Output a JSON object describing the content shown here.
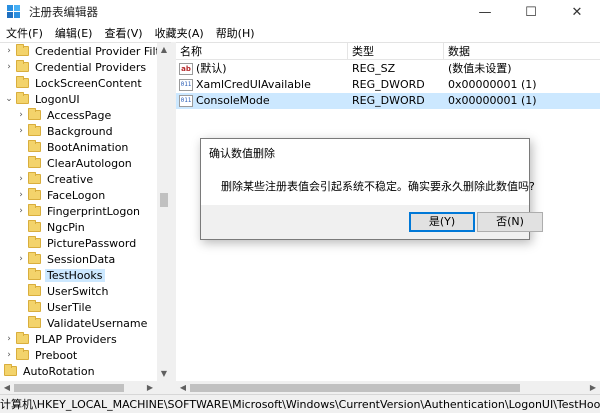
{
  "window": {
    "title": "注册表编辑器",
    "controls": {
      "minimize": "—",
      "maximize": "☐",
      "close": "✕"
    }
  },
  "menu": [
    {
      "label": "文件(F)"
    },
    {
      "label": "编辑(E)"
    },
    {
      "label": "查看(V)"
    },
    {
      "label": "收藏夹(A)"
    },
    {
      "label": "帮助(H)"
    }
  ],
  "tree": {
    "items": [
      {
        "label": "Credential Provider Filte",
        "expandable": true,
        "expanded": false,
        "selected": false
      },
      {
        "label": "Credential Providers",
        "expandable": true,
        "expanded": false,
        "selected": false
      },
      {
        "label": "LockScreenContent",
        "expandable": false,
        "expanded": false,
        "selected": false
      },
      {
        "label": "LogonUI",
        "expandable": true,
        "expanded": true,
        "selected": false
      },
      {
        "label": "AccessPage",
        "expandable": true,
        "expanded": false,
        "selected": false
      },
      {
        "label": "Background",
        "expandable": true,
        "expanded": false,
        "selected": false
      },
      {
        "label": "BootAnimation",
        "expandable": false,
        "expanded": false,
        "selected": false
      },
      {
        "label": "ClearAutologon",
        "expandable": false,
        "expanded": false,
        "selected": false
      },
      {
        "label": "Creative",
        "expandable": true,
        "expanded": false,
        "selected": false
      },
      {
        "label": "FaceLogon",
        "expandable": true,
        "expanded": false,
        "selected": false
      },
      {
        "label": "FingerprintLogon",
        "expandable": true,
        "expanded": false,
        "selected": false
      },
      {
        "label": "NgcPin",
        "expandable": false,
        "expanded": false,
        "selected": false
      },
      {
        "label": "PicturePassword",
        "expandable": false,
        "expanded": false,
        "selected": false
      },
      {
        "label": "SessionData",
        "expandable": true,
        "expanded": false,
        "selected": false
      },
      {
        "label": "TestHooks",
        "expandable": false,
        "expanded": false,
        "selected": true
      },
      {
        "label": "UserSwitch",
        "expandable": false,
        "expanded": false,
        "selected": false
      },
      {
        "label": "UserTile",
        "expandable": false,
        "expanded": false,
        "selected": false
      },
      {
        "label": "ValidateUsername",
        "expandable": false,
        "expanded": false,
        "selected": false
      },
      {
        "label": "PLAP Providers",
        "expandable": true,
        "expanded": false,
        "selected": false
      },
      {
        "label": "Preboot",
        "expandable": true,
        "expanded": false,
        "selected": false
      },
      {
        "label": "AutoRotation",
        "expandable": false,
        "expanded": false,
        "selected": false
      }
    ]
  },
  "list": {
    "columns": {
      "name": "名称",
      "type": "类型",
      "data": "数据"
    },
    "rows": [
      {
        "icon": "string-value-icon",
        "icon_text": "ab",
        "name": "(默认)",
        "type": "REG_SZ",
        "data": "(数值未设置)",
        "selected": false
      },
      {
        "icon": "dword-value-icon",
        "icon_text": "011",
        "name": "XamlCredUIAvailable",
        "type": "REG_DWORD",
        "data": "0x00000001 (1)",
        "selected": false
      },
      {
        "icon": "dword-value-icon",
        "icon_text": "011",
        "name": "ConsoleMode",
        "type": "REG_DWORD",
        "data": "0x00000001 (1)",
        "selected": true
      }
    ]
  },
  "status_bar": {
    "path": "计算机\\HKEY_LOCAL_MACHINE\\SOFTWARE\\Microsoft\\Windows\\CurrentVersion\\Authentication\\LogonUI\\TestHooks"
  },
  "dialog": {
    "title": "确认数值删除",
    "message": "删除某些注册表值会引起系统不稳定。确实要永久删除此数值吗?",
    "icon": "warning-icon",
    "yes_label": "是(Y)",
    "no_label": "否(N)"
  },
  "colors": {
    "selection": "#cce8ff",
    "default_button_border": "#0078d7",
    "folder": "#f3d36b",
    "warning": "#ffcc00"
  }
}
